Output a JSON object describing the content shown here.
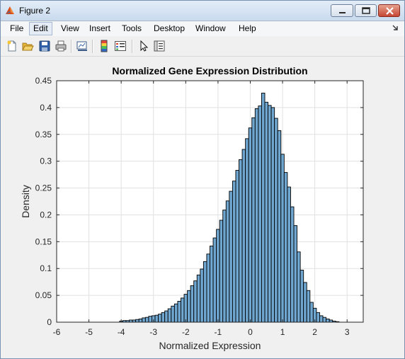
{
  "window": {
    "title": "Figure 2"
  },
  "menubar": {
    "items": [
      "File",
      "Edit",
      "View",
      "Insert",
      "Tools",
      "Desktop",
      "Window",
      "Help"
    ],
    "active": "Edit"
  },
  "toolbar": {
    "buttons": [
      "new-figure-icon",
      "open-file-icon",
      "save-icon",
      "print-icon",
      "link-plot-icon",
      "insert-colorbar-icon",
      "insert-legend-icon",
      "edit-plot-pointer-icon",
      "property-inspector-icon"
    ]
  },
  "colors": {
    "bar_fill": "#6fa7d1",
    "bar_edge": "#000000",
    "axes_bg": "#ffffff",
    "figure_bg": "#f0f0f0",
    "grid": "#e1e1e1"
  },
  "chart_data": {
    "type": "bar",
    "title": "Normalized Gene Expression Distribution",
    "xlabel": "Normalized Expression",
    "ylabel": "Density",
    "xlim": [
      -6,
      3.5
    ],
    "ylim": [
      0,
      0.45
    ],
    "xticks": [
      -6,
      -5,
      -4,
      -3,
      -2,
      -1,
      0,
      1,
      2,
      3
    ],
    "yticks": [
      0,
      0.05,
      0.1,
      0.15,
      0.2,
      0.25,
      0.3,
      0.35,
      0.4,
      0.45
    ],
    "grid": true,
    "bin_width": 0.1,
    "x": [
      -4.0,
      -3.9,
      -3.8,
      -3.7,
      -3.6,
      -3.5,
      -3.4,
      -3.3,
      -3.2,
      -3.1,
      -3.0,
      -2.9,
      -2.8,
      -2.7,
      -2.6,
      -2.5,
      -2.4,
      -2.3,
      -2.2,
      -2.1,
      -2.0,
      -1.9,
      -1.8,
      -1.7,
      -1.6,
      -1.5,
      -1.4,
      -1.3,
      -1.2,
      -1.1,
      -1.0,
      -0.9,
      -0.8,
      -0.7,
      -0.6,
      -0.5,
      -0.4,
      -0.3,
      -0.2,
      -0.1,
      0.0,
      0.1,
      0.2,
      0.3,
      0.4,
      0.5,
      0.6,
      0.7,
      0.8,
      0.9,
      1.0,
      1.1,
      1.2,
      1.3,
      1.4,
      1.5,
      1.6,
      1.7,
      1.8,
      1.9,
      2.0,
      2.1,
      2.2,
      2.3,
      2.4,
      2.5,
      2.6,
      2.7
    ],
    "values": [
      0.002,
      0.003,
      0.003,
      0.004,
      0.004,
      0.005,
      0.006,
      0.008,
      0.009,
      0.011,
      0.012,
      0.013,
      0.015,
      0.018,
      0.021,
      0.025,
      0.03,
      0.034,
      0.039,
      0.045,
      0.052,
      0.059,
      0.068,
      0.077,
      0.088,
      0.099,
      0.113,
      0.127,
      0.142,
      0.157,
      0.173,
      0.19,
      0.209,
      0.226,
      0.244,
      0.263,
      0.283,
      0.303,
      0.322,
      0.342,
      0.362,
      0.381,
      0.398,
      0.403,
      0.427,
      0.41,
      0.404,
      0.4,
      0.38,
      0.357,
      0.313,
      0.279,
      0.252,
      0.215,
      0.18,
      0.131,
      0.097,
      0.074,
      0.059,
      0.037,
      0.026,
      0.018,
      0.012,
      0.009,
      0.006,
      0.004,
      0.002,
      0.001
    ]
  }
}
